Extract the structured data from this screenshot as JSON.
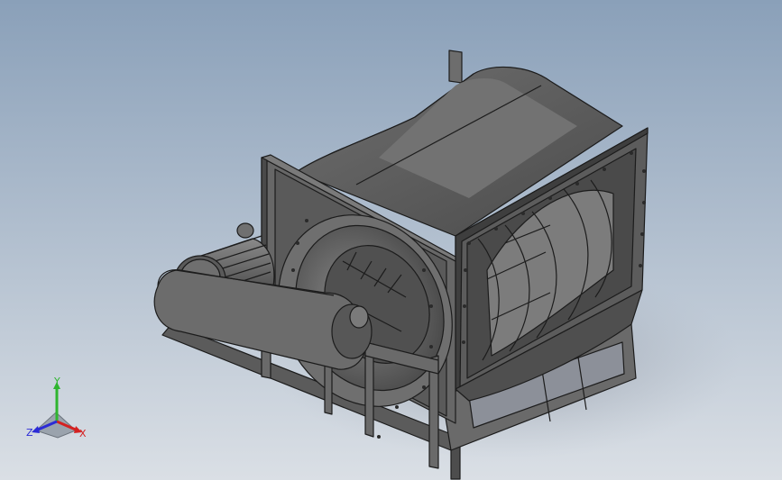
{
  "viewport": {
    "background_top": "#8aa0b9",
    "background_bottom": "#dadfe5",
    "model_color": "#5e5e5e",
    "edge_color": "#1c1c1c"
  },
  "model": {
    "description_icon": "centrifugal-fan-icon"
  },
  "triad": {
    "x_label": "X",
    "y_label": "Y",
    "z_label": "Z",
    "x_color": "#d42121",
    "y_color": "#2fb52f",
    "z_color": "#2b2bd6"
  }
}
